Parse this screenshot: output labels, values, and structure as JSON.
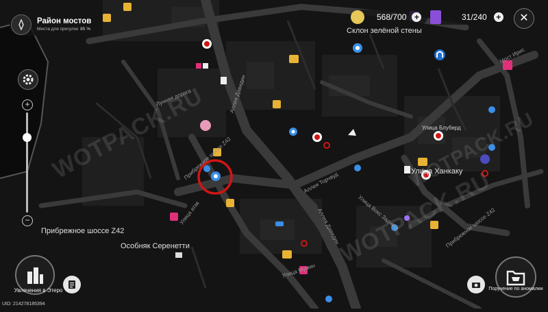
{
  "region": {
    "name": "Район мостов",
    "sub_label": "Места для прогулок",
    "progress": "85 %"
  },
  "resources": [
    {
      "value": "568/700",
      "plus": "+"
    },
    {
      "value": "31/240",
      "plus": "+"
    }
  ],
  "controls": {
    "close": "✕",
    "zoom_in": "+",
    "zoom_out": "−"
  },
  "places": {
    "slope": "Склон зелёной стены",
    "bluebird": "Улица Блуберд",
    "hankaku": "Улица Ханкаку",
    "coastal": "Прибрежное шоссе Z42",
    "mansion": "Особняк Серенетти"
  },
  "roads": {
    "iris": "Мост Ирис",
    "davidin_1": "Аллея Давидин",
    "davidin_2": "Аллея Давидин",
    "lunar": "Лунная дорога",
    "z42_mid": "Прибрежное шоссе Z42",
    "z42_right": "Прибрежное шоссе Z42",
    "torchwood": "Аллея Торчвуд",
    "vox": "Улица Вокс Заднего",
    "mumin": "Улица Мумин",
    "attack": "Улица атак"
  },
  "watermarks": [
    "WOTPACK.RU",
    "WOTPACK.RU",
    "WOTPACK.RU"
  ],
  "bottom": {
    "hobbies_label": "Увлечения в Этеро",
    "anomaly_label": "Поручение по аномалии",
    "uid": "UID: 214278185394"
  },
  "colors": {
    "quest_marker": "#d01515",
    "map_bg": "#141414",
    "icon_pink": "#e0307a",
    "icon_blue": "#3a8fe8",
    "icon_gold": "#e8b234"
  }
}
